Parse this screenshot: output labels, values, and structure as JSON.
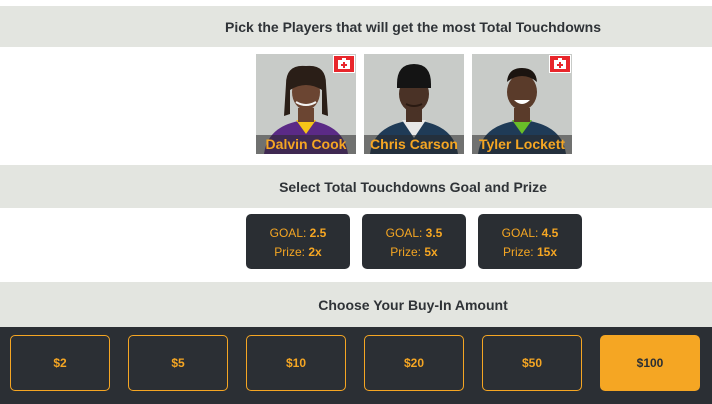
{
  "players_section": {
    "heading": "Pick the Players that will get the most Total Touchdowns",
    "players": [
      {
        "name": "Dalvin Cook",
        "injured": true,
        "jersey_color": "#5b2a86"
      },
      {
        "name": "Chris Carson",
        "injured": false,
        "jersey_color": "#1f3b57"
      },
      {
        "name": "Tyler Lockett",
        "injured": true,
        "jersey_color": "#1f3b57"
      }
    ]
  },
  "goal_section": {
    "heading": "Select Total Touchdowns Goal and Prize",
    "goal_label": "GOAL:",
    "prize_label": "Prize:",
    "options": [
      {
        "goal": "2.5",
        "prize": "2x"
      },
      {
        "goal": "3.5",
        "prize": "5x"
      },
      {
        "goal": "4.5",
        "prize": "15x"
      }
    ]
  },
  "buyin_section": {
    "heading": "Choose Your Buy-In Amount",
    "amounts": [
      "$2",
      "$5",
      "$10",
      "$20",
      "$50",
      "$100"
    ],
    "selected": "$100"
  },
  "colors": {
    "accent": "#f5a623",
    "dark": "#2b2f34",
    "band": "#e3e5e0",
    "injury": "#e8262b"
  }
}
